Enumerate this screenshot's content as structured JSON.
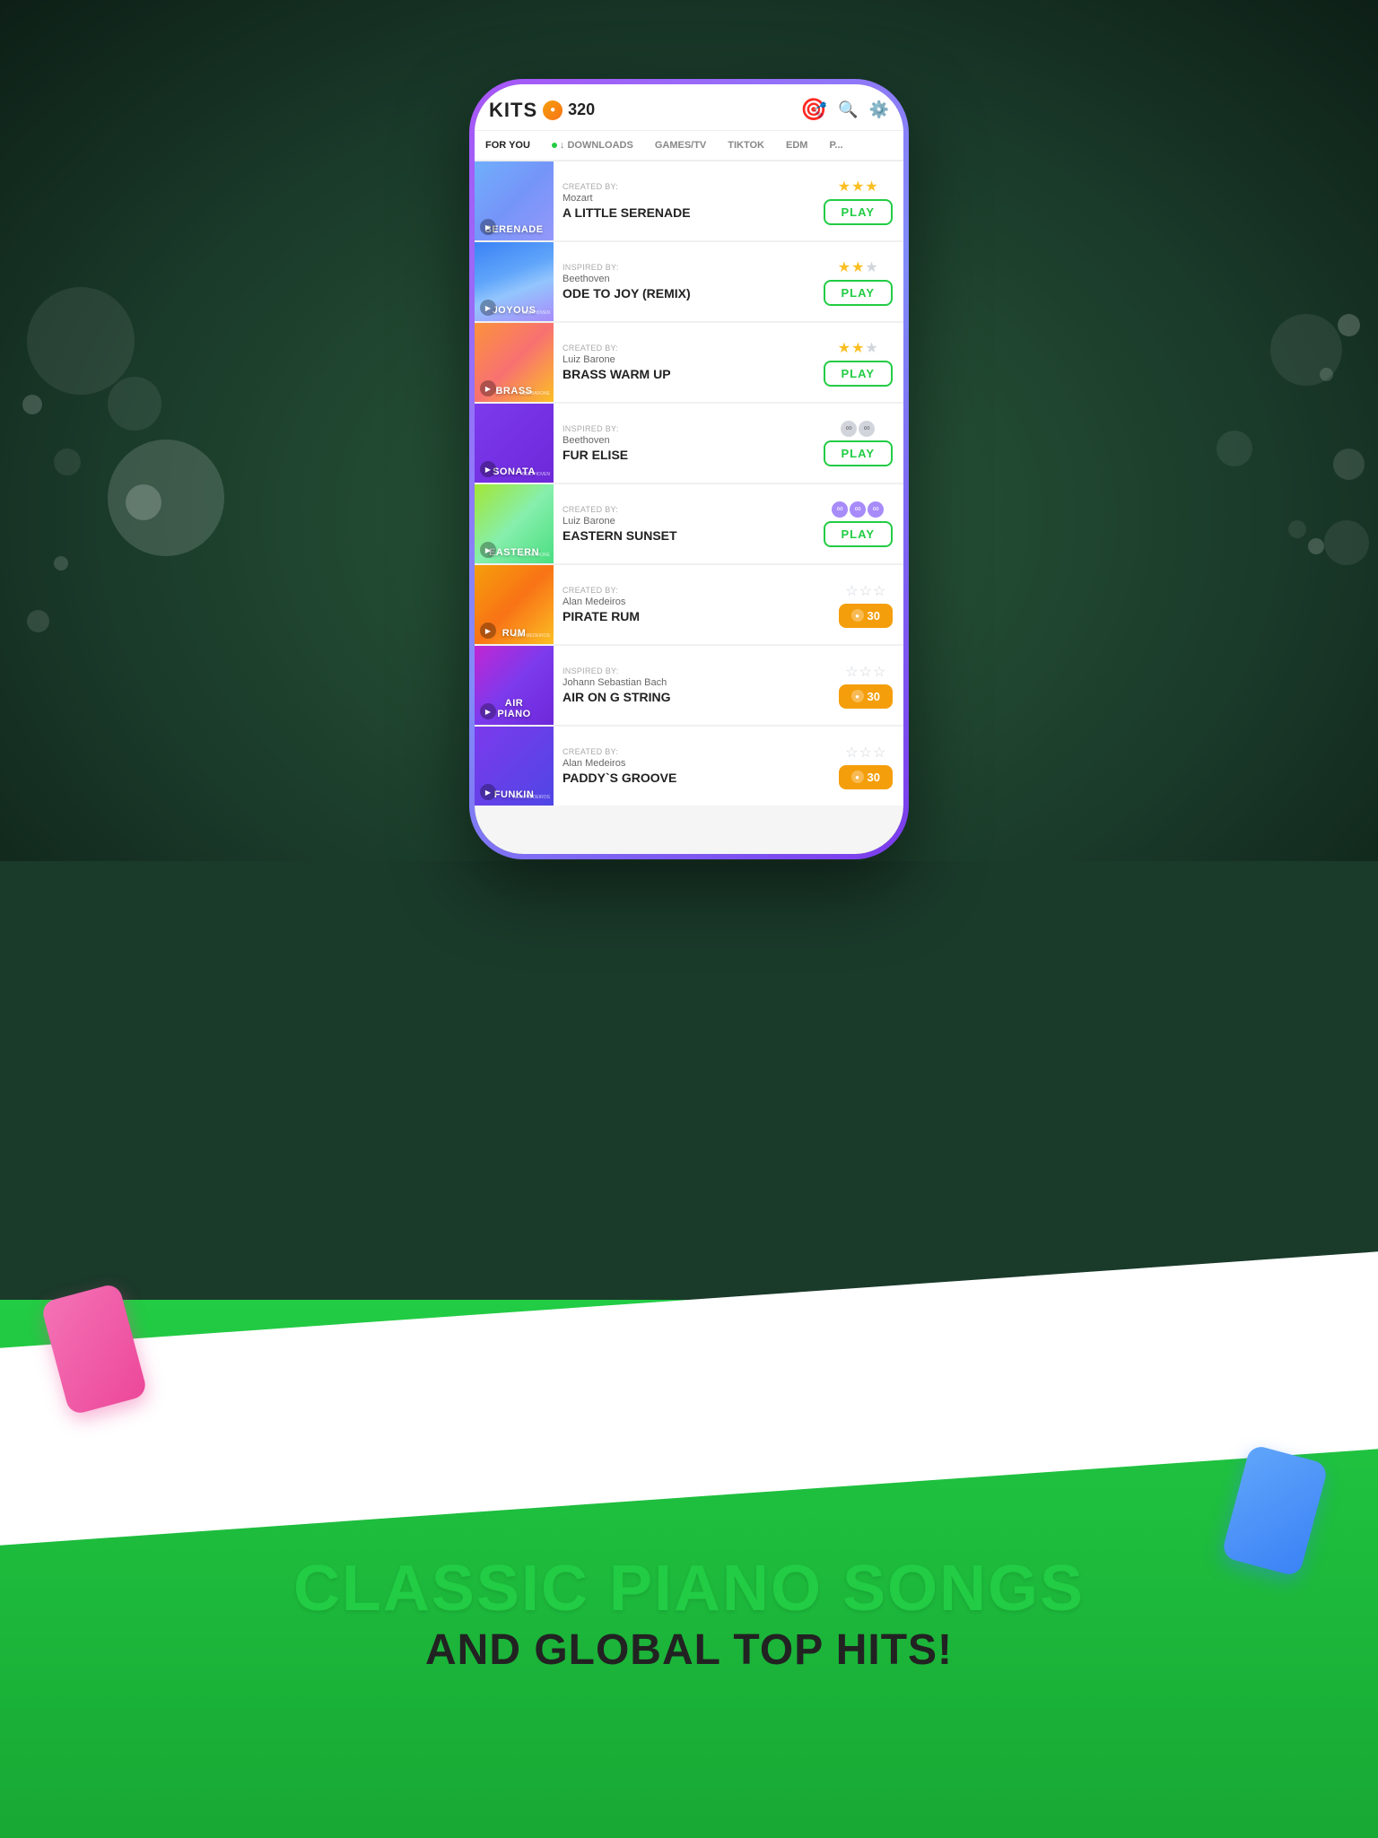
{
  "background": {
    "topColor": "#1a3a2a",
    "bottomColor": "#22cc44"
  },
  "app": {
    "logo": "KITS",
    "coins": "320",
    "headerEmoji": "🎯"
  },
  "tabs": [
    {
      "label": "FOR YOU",
      "active": true
    },
    {
      "label": "↓ DOWNLOADS",
      "active": false
    },
    {
      "label": "GAMES/TV",
      "active": false
    },
    {
      "label": "TIKTOK",
      "active": false
    },
    {
      "label": "EDM",
      "active": false
    },
    {
      "label": "P...",
      "active": false
    }
  ],
  "songs": [
    {
      "id": "serenade",
      "thumbLabel": "SERENADE",
      "thumbStyle": "serenade",
      "createdBy": "Created by:",
      "composer": "Mozart",
      "title": "A LITTLE SERENADE",
      "stars": 3,
      "maxStars": 3,
      "action": "play",
      "cost": null
    },
    {
      "id": "joyous",
      "thumbLabel": "JOYOUS",
      "thumbStyle": "joyous",
      "createdBy": "Inspired by:",
      "composer": "Beethoven",
      "title": "ODE TO JOY (REMIX)",
      "stars": 2,
      "maxStars": 3,
      "action": "play",
      "cost": null
    },
    {
      "id": "brass",
      "thumbLabel": "BRASS",
      "thumbStyle": "brass",
      "createdBy": "Created by:",
      "composer": "Luiz Barone",
      "title": "BRASS WARM UP",
      "stars": 2,
      "maxStars": 3,
      "action": "play",
      "cost": null
    },
    {
      "id": "sonata",
      "thumbLabel": "SONATA",
      "thumbStyle": "sonata",
      "createdBy": "Inspired by:",
      "composer": "Beethoven",
      "title": "FUR ELISE",
      "stars": 0,
      "maxStars": 3,
      "action": "play",
      "cost": null,
      "infinityType": "locked"
    },
    {
      "id": "eastern",
      "thumbLabel": "EASTERN",
      "thumbStyle": "eastern",
      "createdBy": "Created by:",
      "composer": "Luiz Barone",
      "title": "EASTERN SUNSET",
      "stars": 0,
      "maxStars": 3,
      "action": "play",
      "cost": null,
      "infinityType": "active"
    },
    {
      "id": "rum",
      "thumbLabel": "RUM",
      "thumbStyle": "rum",
      "createdBy": "Created by:",
      "composer": "Alan Medeiros",
      "title": "PIRATE RUM",
      "stars": 0,
      "maxStars": 3,
      "action": "coins",
      "cost": "30"
    },
    {
      "id": "airpiano",
      "thumbLabel": "AIR\nPIANO",
      "thumbStyle": "airpiano",
      "createdBy": "Inspired by:",
      "composer": "Johann Sebastian Bach",
      "title": "AIR ON G STRING",
      "stars": 0,
      "maxStars": 3,
      "action": "coins",
      "cost": "30"
    },
    {
      "id": "funkin",
      "thumbLabel": "FUNKIN",
      "thumbStyle": "funkin",
      "createdBy": "Created by:",
      "composer": "Alan Medeiros",
      "title": "PADDY`S GROOVE",
      "stars": 0,
      "maxStars": 3,
      "action": "coins",
      "cost": "30"
    }
  ],
  "bottomText": {
    "line1": "CLASSIC PIANO SONGS",
    "line2": "AND GLOBAL TOP HITS!"
  },
  "buttons": {
    "play": "PLAY"
  }
}
